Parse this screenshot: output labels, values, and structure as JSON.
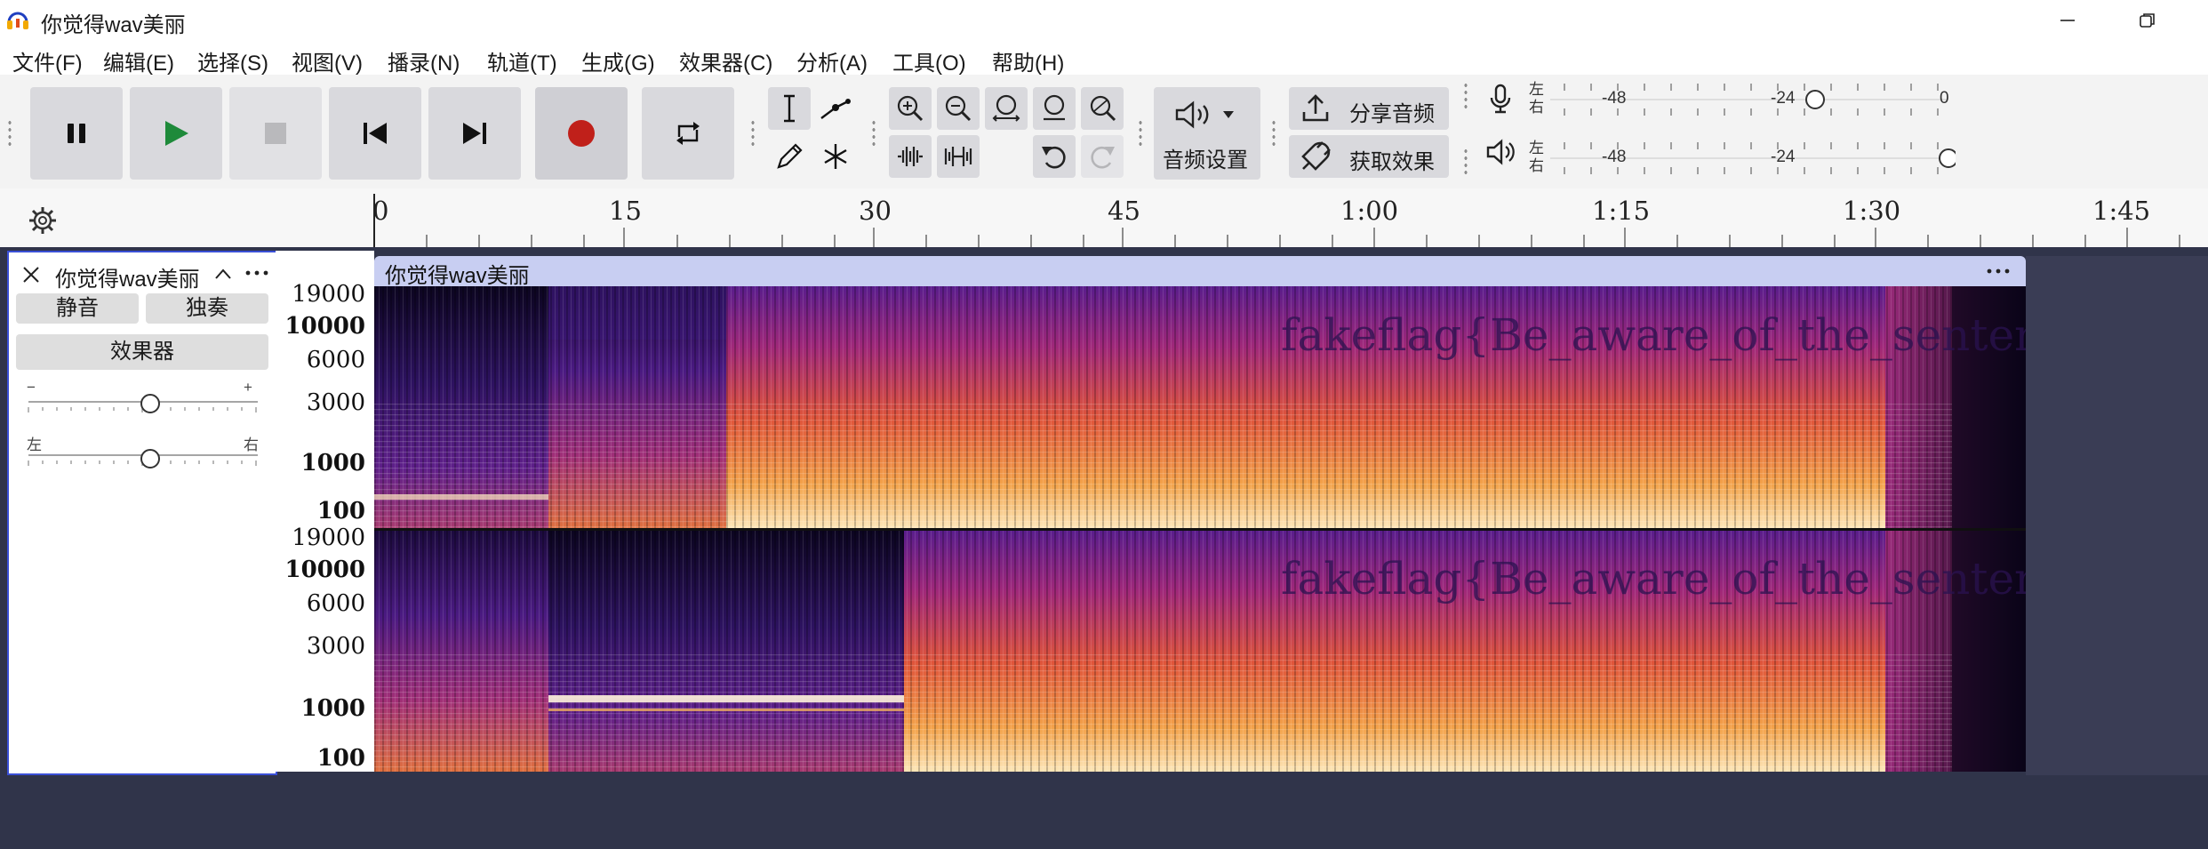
{
  "window": {
    "title": "你觉得wav美丽"
  },
  "menu": [
    "文件(F)",
    "编辑(E)",
    "选择(S)",
    "视图(V)",
    "播录(N)",
    "轨道(T)",
    "生成(G)",
    "效果器(C)",
    "分析(A)",
    "工具(O)",
    "帮助(H)"
  ],
  "toolbar": {
    "audio_setup_label": "音频设置",
    "share_audio_label": "分享音频",
    "get_effects_label": "获取效果"
  },
  "meters": {
    "record": {
      "left": "左",
      "right": "右",
      "ticks": [
        "-48",
        "-24",
        "0"
      ]
    },
    "playback": {
      "left": "左",
      "right": "右",
      "ticks": [
        "-48",
        "-24"
      ]
    }
  },
  "ruler": {
    "labels": [
      "0",
      "15",
      "30",
      "45",
      "1:00",
      "1:15",
      "1:30",
      "1:45"
    ]
  },
  "track": {
    "name": "你觉得wav美丽",
    "mute_label": "静音",
    "solo_label": "独奏",
    "effects_label": "效果器",
    "gain": {
      "min_label": "−",
      "max_label": "+"
    },
    "pan": {
      "left_label": "左",
      "right_label": "右"
    }
  },
  "clip": {
    "name": "你觉得wav美丽",
    "hidden_text": "fakeflag{Be_aware_of_the_sentences_initials}"
  },
  "freq_scale": [
    "19000",
    "10000",
    "6000",
    "3000",
    "1000",
    "100"
  ]
}
